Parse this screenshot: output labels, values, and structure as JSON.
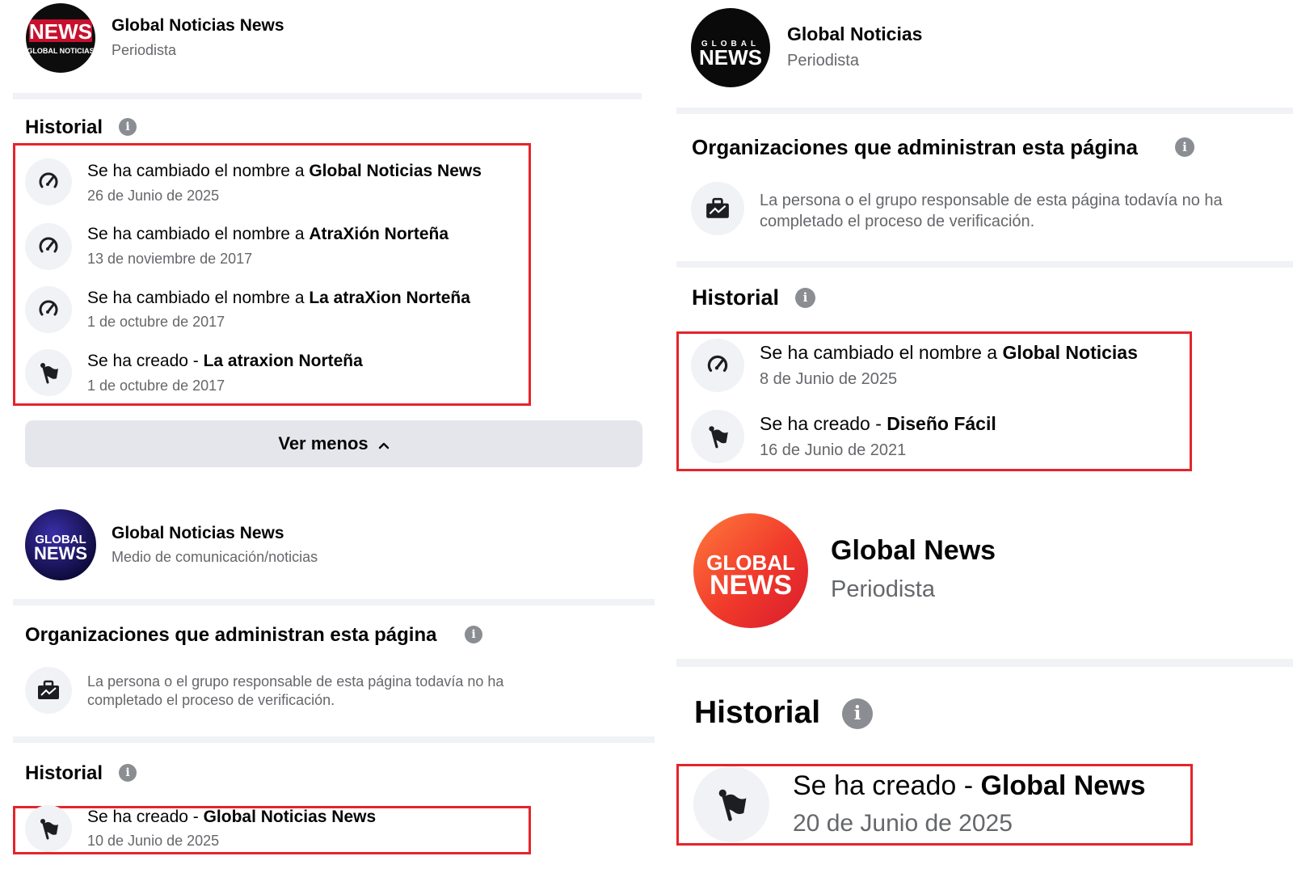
{
  "panels": {
    "tl": {
      "name": "Global Noticias News",
      "category": "Periodista",
      "logo": {
        "line1": "NEWS",
        "line2": "GLOBAL NOTICIAS"
      },
      "historial": {
        "title": "Historial",
        "events": [
          {
            "prefix": "Se ha cambiado el nombre a ",
            "bold": "Global Noticias News",
            "date": "26 de Junio de 2025",
            "icon": "rename-icon"
          },
          {
            "prefix": "Se ha cambiado el nombre a ",
            "bold": "AtraXión Norteña",
            "date": "13 de noviembre de 2017",
            "icon": "rename-icon"
          },
          {
            "prefix": "Se ha cambiado el nombre a ",
            "bold": "La atraXion Norteña",
            "date": "1 de octubre de 2017",
            "icon": "rename-icon"
          },
          {
            "prefix": "Se ha creado - ",
            "bold": "La atraxion Norteña",
            "date": "1 de octubre de 2017",
            "icon": "flag-icon"
          }
        ]
      },
      "button": "Ver menos"
    },
    "bl": {
      "name": "Global Noticias News",
      "category": "Medio de comunicación/noticias",
      "logo": {
        "line1": "GLOBAL",
        "line2": "NEWS"
      },
      "orgs": {
        "title": "Organizaciones que administran esta página",
        "text": "La persona o el grupo responsable de esta página todavía no ha completado el proceso de verificación."
      },
      "historial": {
        "title": "Historial",
        "events": [
          {
            "prefix": "Se ha creado - ",
            "bold": "Global Noticias News",
            "date": "10 de Junio de 2025",
            "icon": "flag-icon"
          }
        ]
      }
    },
    "tr": {
      "name": "Global Noticias",
      "category": "Periodista",
      "logo": {
        "line1": "GLOBAL",
        "line2": "NEWS"
      },
      "orgs": {
        "title": "Organizaciones que administran esta página",
        "text": "La persona o el grupo responsable de esta página todavía no ha completado el proceso de verificación."
      },
      "historial": {
        "title": "Historial",
        "events": [
          {
            "prefix": "Se ha cambiado el nombre a ",
            "bold": "Global Noticias",
            "date": "8 de Junio de 2025",
            "icon": "rename-icon"
          },
          {
            "prefix": "Se ha creado - ",
            "bold": "Diseño Fácil",
            "date": "16 de Junio de 2021",
            "icon": "flag-icon"
          }
        ]
      }
    },
    "br": {
      "name": "Global News",
      "category": "Periodista",
      "logo": {
        "line1": "GLOBAL",
        "line2": "NEWS"
      },
      "historial": {
        "title": "Historial",
        "events": [
          {
            "prefix": "Se ha creado - ",
            "bold": "Global News",
            "date": "20 de Junio de 2025",
            "icon": "flag-icon"
          }
        ]
      }
    }
  },
  "colors": {
    "highlight": "#e5242b",
    "secondary_text": "#65676b",
    "separator": "#f0f2f5",
    "button_bg": "#e4e6eb"
  }
}
